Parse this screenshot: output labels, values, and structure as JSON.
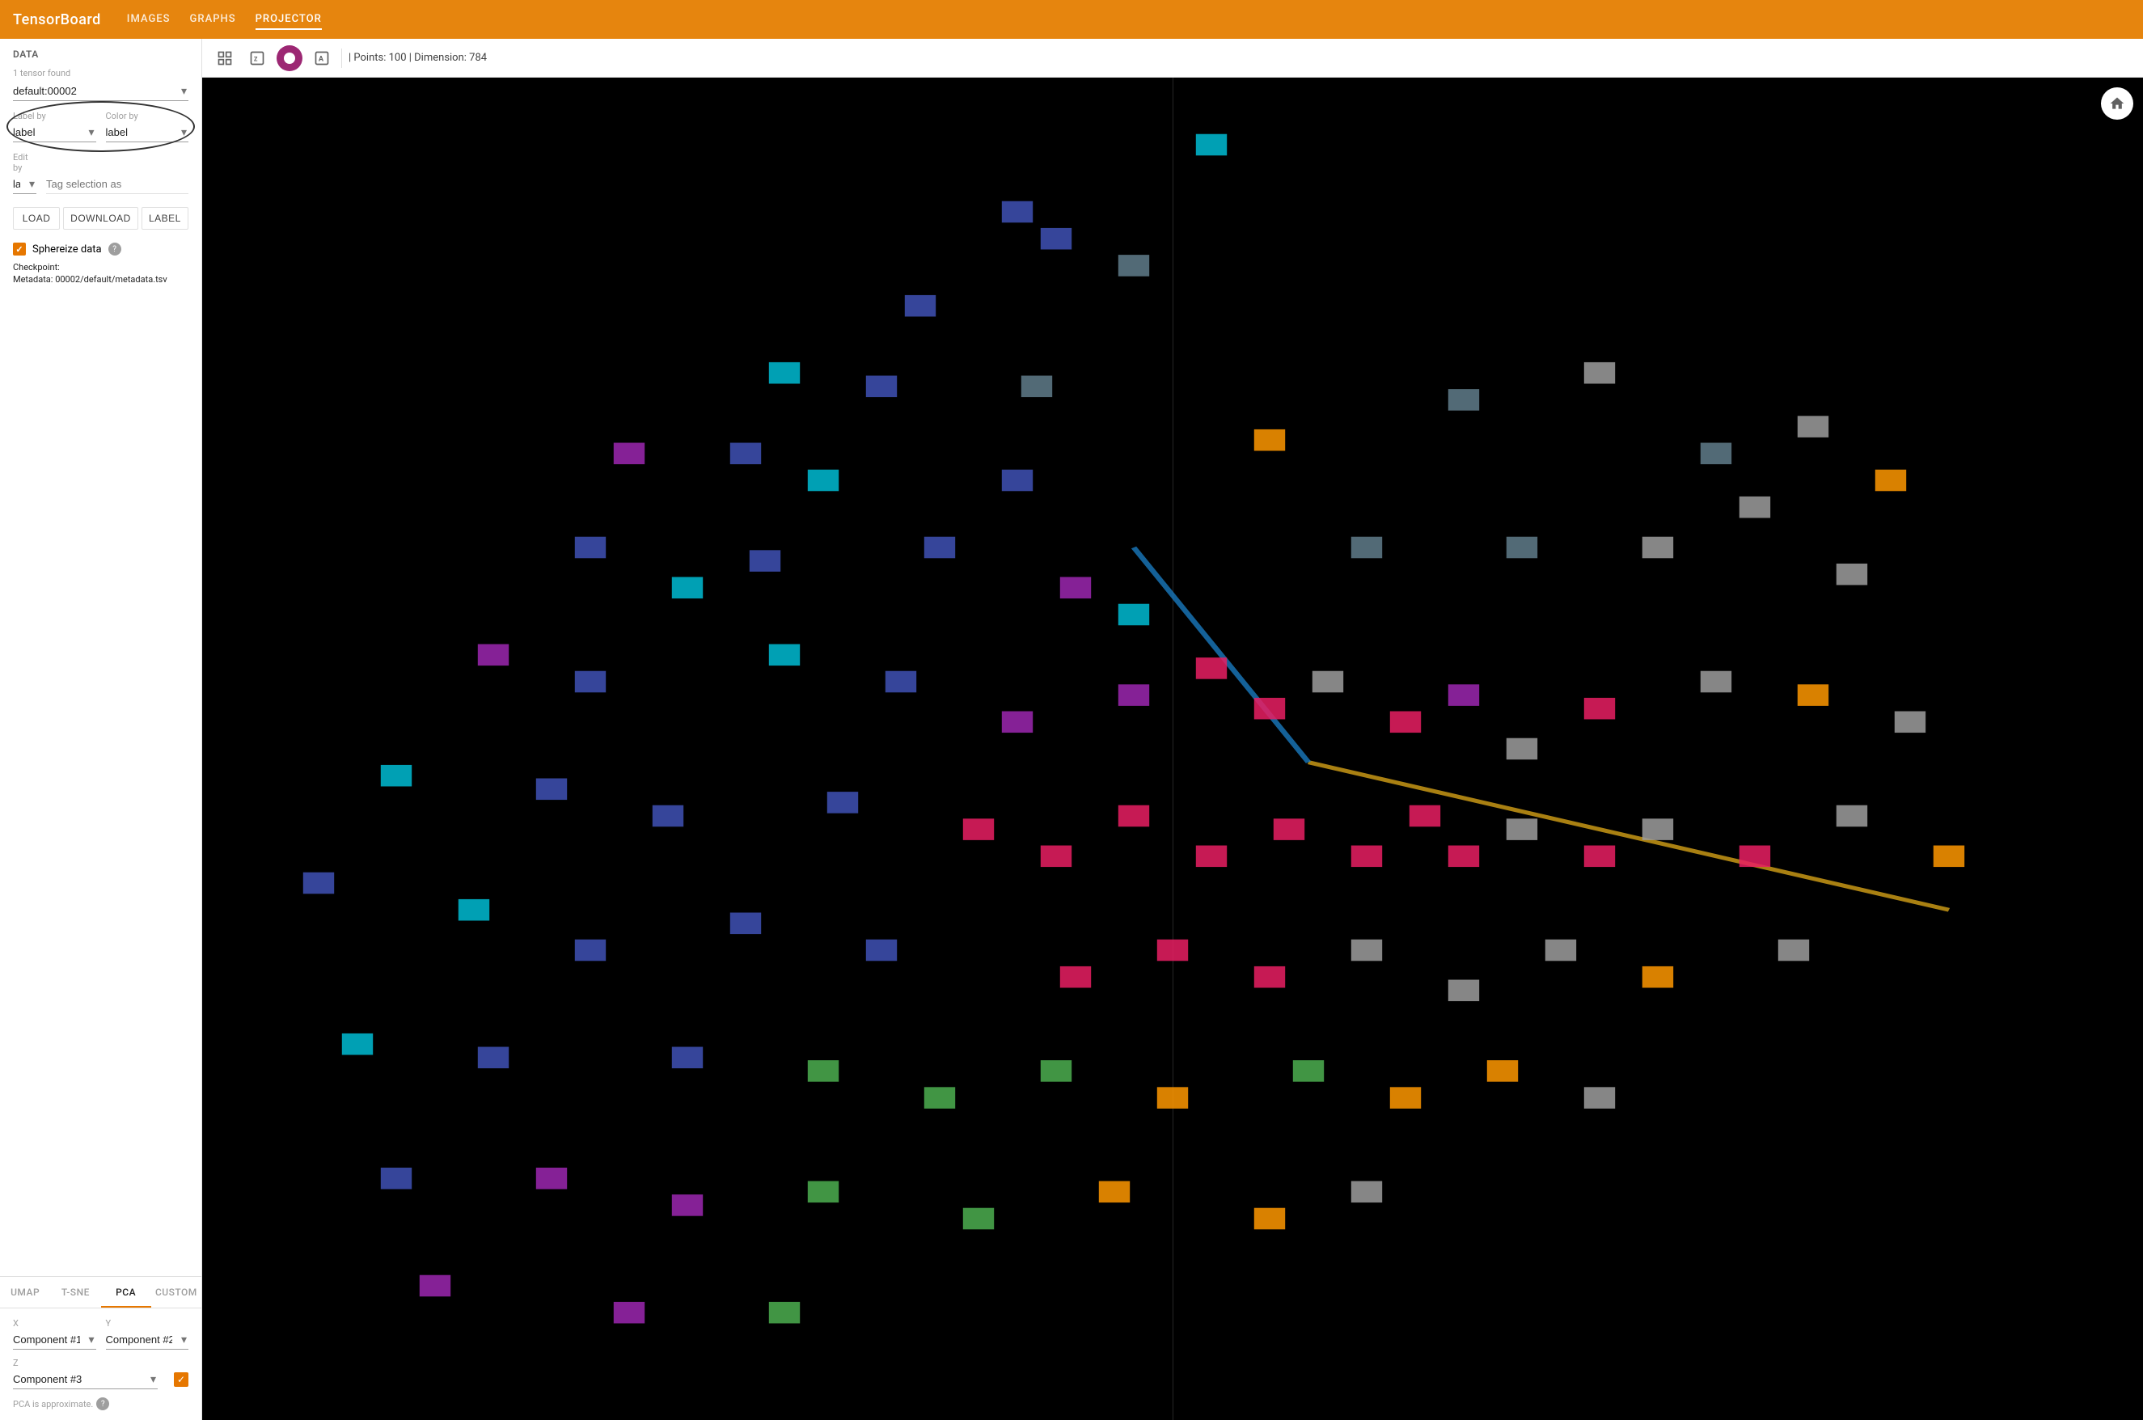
{
  "brand": "TensorBoard",
  "nav": {
    "links": [
      {
        "id": "images",
        "label": "IMAGES"
      },
      {
        "id": "graphs",
        "label": "GRAPHS"
      },
      {
        "id": "projector",
        "label": "PROJECTOR",
        "active": true
      }
    ]
  },
  "sidebar": {
    "data_section": "DATA",
    "tensor_found": "1 tensor found",
    "tensor_value": "default:00002",
    "label_by_label": "Label by",
    "label_by_value": "label",
    "color_by_label": "Color by",
    "color_by_value": "label",
    "edit_by_label": "Edit by",
    "edit_by_value": "label",
    "tag_placeholder": "Tag selection as",
    "btn_load": "Load",
    "btn_download": "Download",
    "btn_label": "Label",
    "sphereize_label": "Sphereize data",
    "checkpoint_label": "Checkpoint:",
    "checkpoint_value": "",
    "metadata_label": "Metadata:",
    "metadata_value": "00002/default/metadata.tsv"
  },
  "tabs": [
    {
      "id": "umap",
      "label": "UMAP"
    },
    {
      "id": "tsne",
      "label": "T-SNE"
    },
    {
      "id": "pca",
      "label": "PCA",
      "active": true
    },
    {
      "id": "custom",
      "label": "CUSTOM"
    }
  ],
  "pca": {
    "x_label": "X",
    "x_value": "Component #1",
    "y_label": "Y",
    "y_value": "Component #2",
    "z_label": "Z",
    "z_value": "Component #3",
    "note": "PCA is approximate."
  },
  "toolbar": {
    "points_info": "| Points: 100 | Dimension: 784"
  },
  "points": [
    {
      "x": 52,
      "y": 5,
      "color": "#00bcd4"
    },
    {
      "x": 42,
      "y": 10,
      "color": "#3f51b5"
    },
    {
      "x": 44,
      "y": 12,
      "color": "#3f51b5"
    },
    {
      "x": 48,
      "y": 14,
      "color": "#607d8b"
    },
    {
      "x": 37,
      "y": 17,
      "color": "#3f51b5"
    },
    {
      "x": 30,
      "y": 22,
      "color": "#00bcd4"
    },
    {
      "x": 35,
      "y": 23,
      "color": "#3f51b5"
    },
    {
      "x": 43,
      "y": 23,
      "color": "#607d8b"
    },
    {
      "x": 22,
      "y": 28,
      "color": "#9c27b0"
    },
    {
      "x": 28,
      "y": 28,
      "color": "#3f51b5"
    },
    {
      "x": 32,
      "y": 30,
      "color": "#00bcd4"
    },
    {
      "x": 42,
      "y": 30,
      "color": "#3f51b5"
    },
    {
      "x": 55,
      "y": 27,
      "color": "#ff9800"
    },
    {
      "x": 65,
      "y": 24,
      "color": "#607d8b"
    },
    {
      "x": 72,
      "y": 22,
      "color": "#9e9e9e"
    },
    {
      "x": 78,
      "y": 28,
      "color": "#607d8b"
    },
    {
      "x": 80,
      "y": 32,
      "color": "#9e9e9e"
    },
    {
      "x": 83,
      "y": 26,
      "color": "#9e9e9e"
    },
    {
      "x": 87,
      "y": 30,
      "color": "#ff9800"
    },
    {
      "x": 20,
      "y": 35,
      "color": "#3f51b5"
    },
    {
      "x": 25,
      "y": 38,
      "color": "#00bcd4"
    },
    {
      "x": 29,
      "y": 36,
      "color": "#3f51b5"
    },
    {
      "x": 38,
      "y": 35,
      "color": "#3f51b5"
    },
    {
      "x": 45,
      "y": 38,
      "color": "#9c27b0"
    },
    {
      "x": 48,
      "y": 40,
      "color": "#00bcd4"
    },
    {
      "x": 60,
      "y": 35,
      "color": "#607d8b"
    },
    {
      "x": 68,
      "y": 35,
      "color": "#607d8b"
    },
    {
      "x": 75,
      "y": 35,
      "color": "#9e9e9e"
    },
    {
      "x": 85,
      "y": 37,
      "color": "#9e9e9e"
    },
    {
      "x": 15,
      "y": 43,
      "color": "#9c27b0"
    },
    {
      "x": 20,
      "y": 45,
      "color": "#3f51b5"
    },
    {
      "x": 30,
      "y": 43,
      "color": "#00bcd4"
    },
    {
      "x": 36,
      "y": 45,
      "color": "#3f51b5"
    },
    {
      "x": 42,
      "y": 48,
      "color": "#9c27b0"
    },
    {
      "x": 48,
      "y": 46,
      "color": "#9c27b0"
    },
    {
      "x": 52,
      "y": 44,
      "color": "#e91e63"
    },
    {
      "x": 55,
      "y": 47,
      "color": "#e91e63"
    },
    {
      "x": 58,
      "y": 45,
      "color": "#9e9e9e"
    },
    {
      "x": 62,
      "y": 48,
      "color": "#e91e63"
    },
    {
      "x": 65,
      "y": 46,
      "color": "#9c27b0"
    },
    {
      "x": 68,
      "y": 50,
      "color": "#9e9e9e"
    },
    {
      "x": 72,
      "y": 47,
      "color": "#e91e63"
    },
    {
      "x": 78,
      "y": 45,
      "color": "#9e9e9e"
    },
    {
      "x": 83,
      "y": 46,
      "color": "#ff9800"
    },
    {
      "x": 88,
      "y": 48,
      "color": "#9e9e9e"
    },
    {
      "x": 10,
      "y": 52,
      "color": "#00bcd4"
    },
    {
      "x": 18,
      "y": 53,
      "color": "#3f51b5"
    },
    {
      "x": 24,
      "y": 55,
      "color": "#3f51b5"
    },
    {
      "x": 33,
      "y": 54,
      "color": "#3f51b5"
    },
    {
      "x": 40,
      "y": 56,
      "color": "#e91e63"
    },
    {
      "x": 44,
      "y": 58,
      "color": "#e91e63"
    },
    {
      "x": 48,
      "y": 55,
      "color": "#e91e63"
    },
    {
      "x": 52,
      "y": 58,
      "color": "#e91e63"
    },
    {
      "x": 56,
      "y": 56,
      "color": "#e91e63"
    },
    {
      "x": 60,
      "y": 58,
      "color": "#e91e63"
    },
    {
      "x": 63,
      "y": 55,
      "color": "#e91e63"
    },
    {
      "x": 65,
      "y": 58,
      "color": "#e91e63"
    },
    {
      "x": 68,
      "y": 56,
      "color": "#9e9e9e"
    },
    {
      "x": 72,
      "y": 58,
      "color": "#e91e63"
    },
    {
      "x": 75,
      "y": 56,
      "color": "#9e9e9e"
    },
    {
      "x": 80,
      "y": 58,
      "color": "#e91e63"
    },
    {
      "x": 85,
      "y": 55,
      "color": "#9e9e9e"
    },
    {
      "x": 90,
      "y": 58,
      "color": "#ff9800"
    },
    {
      "x": 6,
      "y": 60,
      "color": "#3f51b5"
    },
    {
      "x": 14,
      "y": 62,
      "color": "#00bcd4"
    },
    {
      "x": 20,
      "y": 65,
      "color": "#3f51b5"
    },
    {
      "x": 28,
      "y": 63,
      "color": "#3f51b5"
    },
    {
      "x": 35,
      "y": 65,
      "color": "#3f51b5"
    },
    {
      "x": 45,
      "y": 67,
      "color": "#e91e63"
    },
    {
      "x": 50,
      "y": 65,
      "color": "#e91e63"
    },
    {
      "x": 55,
      "y": 67,
      "color": "#e91e63"
    },
    {
      "x": 60,
      "y": 65,
      "color": "#9e9e9e"
    },
    {
      "x": 65,
      "y": 68,
      "color": "#9e9e9e"
    },
    {
      "x": 70,
      "y": 65,
      "color": "#9e9e9e"
    },
    {
      "x": 75,
      "y": 67,
      "color": "#ff9800"
    },
    {
      "x": 82,
      "y": 65,
      "color": "#9e9e9e"
    },
    {
      "x": 8,
      "y": 72,
      "color": "#00bcd4"
    },
    {
      "x": 15,
      "y": 73,
      "color": "#3f51b5"
    },
    {
      "x": 25,
      "y": 73,
      "color": "#3f51b5"
    },
    {
      "x": 32,
      "y": 74,
      "color": "#4caf50"
    },
    {
      "x": 38,
      "y": 76,
      "color": "#4caf50"
    },
    {
      "x": 44,
      "y": 74,
      "color": "#4caf50"
    },
    {
      "x": 50,
      "y": 76,
      "color": "#ff9800"
    },
    {
      "x": 57,
      "y": 74,
      "color": "#4caf50"
    },
    {
      "x": 62,
      "y": 76,
      "color": "#ff9800"
    },
    {
      "x": 67,
      "y": 74,
      "color": "#ff9800"
    },
    {
      "x": 72,
      "y": 76,
      "color": "#9e9e9e"
    },
    {
      "x": 10,
      "y": 82,
      "color": "#3f51b5"
    },
    {
      "x": 18,
      "y": 82,
      "color": "#9c27b0"
    },
    {
      "x": 25,
      "y": 84,
      "color": "#9c27b0"
    },
    {
      "x": 32,
      "y": 83,
      "color": "#4caf50"
    },
    {
      "x": 40,
      "y": 85,
      "color": "#4caf50"
    },
    {
      "x": 47,
      "y": 83,
      "color": "#ff9800"
    },
    {
      "x": 55,
      "y": 85,
      "color": "#ff9800"
    },
    {
      "x": 60,
      "y": 83,
      "color": "#9e9e9e"
    },
    {
      "x": 12,
      "y": 90,
      "color": "#9c27b0"
    },
    {
      "x": 22,
      "y": 92,
      "color": "#9c27b0"
    },
    {
      "x": 30,
      "y": 92,
      "color": "#4caf50"
    }
  ]
}
